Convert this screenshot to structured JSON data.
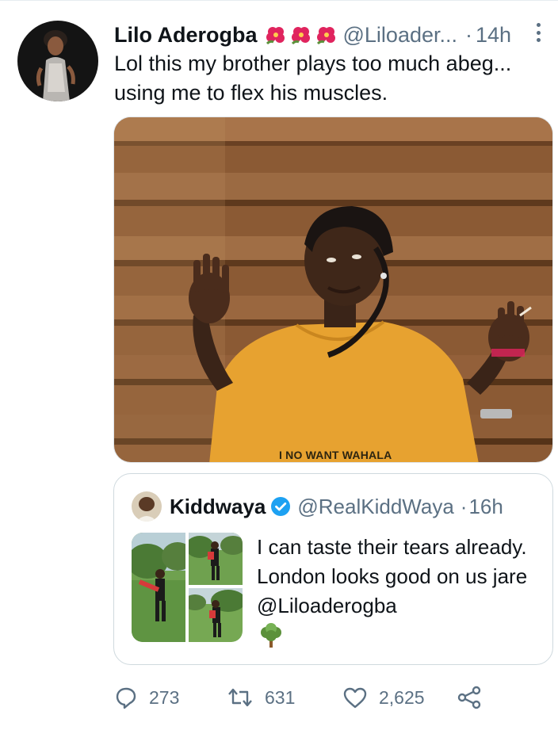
{
  "tweet": {
    "display_name": "Lilo Aderogba",
    "name_emojis": [
      "hibiscus",
      "hibiscus",
      "hibiscus"
    ],
    "handle": "@Liloader...",
    "separator": "·",
    "time": "14h",
    "text_line1": "Lol this my brother plays too much abeg...",
    "text_line2": "using me to flex his muscles.",
    "media_caption": "I NO WANT WAHALA"
  },
  "quote": {
    "display_name": "Kiddwaya",
    "verified": true,
    "handle": "@RealKiddWaya",
    "separator": "·",
    "time": "16h",
    "text": "I can taste their tears already. London looks good on us jare @Liloaderogba",
    "trailing_emoji": "deciduous-tree"
  },
  "actions": {
    "replies": "273",
    "retweets": "631",
    "likes": "2,625"
  },
  "colors": {
    "text_primary": "#0f1419",
    "text_secondary": "#5b7083",
    "verified_blue": "#1da1f2",
    "border": "#cfd9de"
  }
}
